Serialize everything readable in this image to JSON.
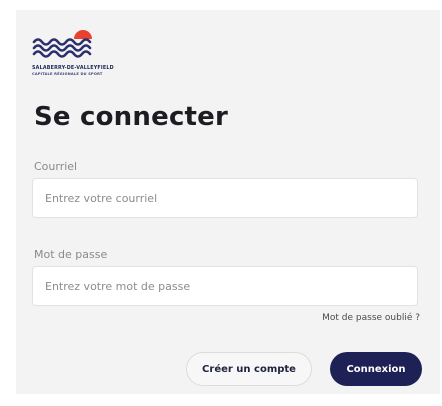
{
  "logo": {
    "name_line1": "SALABERRY-DE-VALLEYFIELD",
    "name_line2": "CAPITALE RÉGIONALE DU SPORT",
    "colors": {
      "waves": "#2b2f6b",
      "sun": "#e8412f"
    }
  },
  "form": {
    "title": "Se connecter",
    "email": {
      "label": "Courriel",
      "placeholder": "Entrez votre courriel",
      "value": ""
    },
    "password": {
      "label": "Mot de passe",
      "placeholder": "Entrez votre mot de passe",
      "value": ""
    },
    "forgot_password_label": "Mot de passe oublié ?",
    "create_account_label": "Créer un compte",
    "login_label": "Connexion"
  },
  "colors": {
    "primary": "#1e2156",
    "card_background": "#f3f3f3"
  }
}
